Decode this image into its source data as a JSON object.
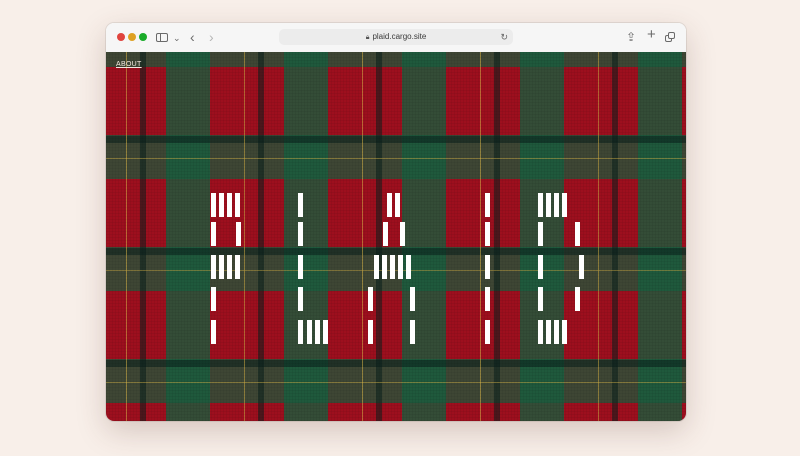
{
  "browser": {
    "url": "plaid.cargo.site"
  },
  "page": {
    "nav_about": "ABOUT",
    "word": [
      "P",
      "L",
      "A",
      "I",
      "D"
    ]
  }
}
